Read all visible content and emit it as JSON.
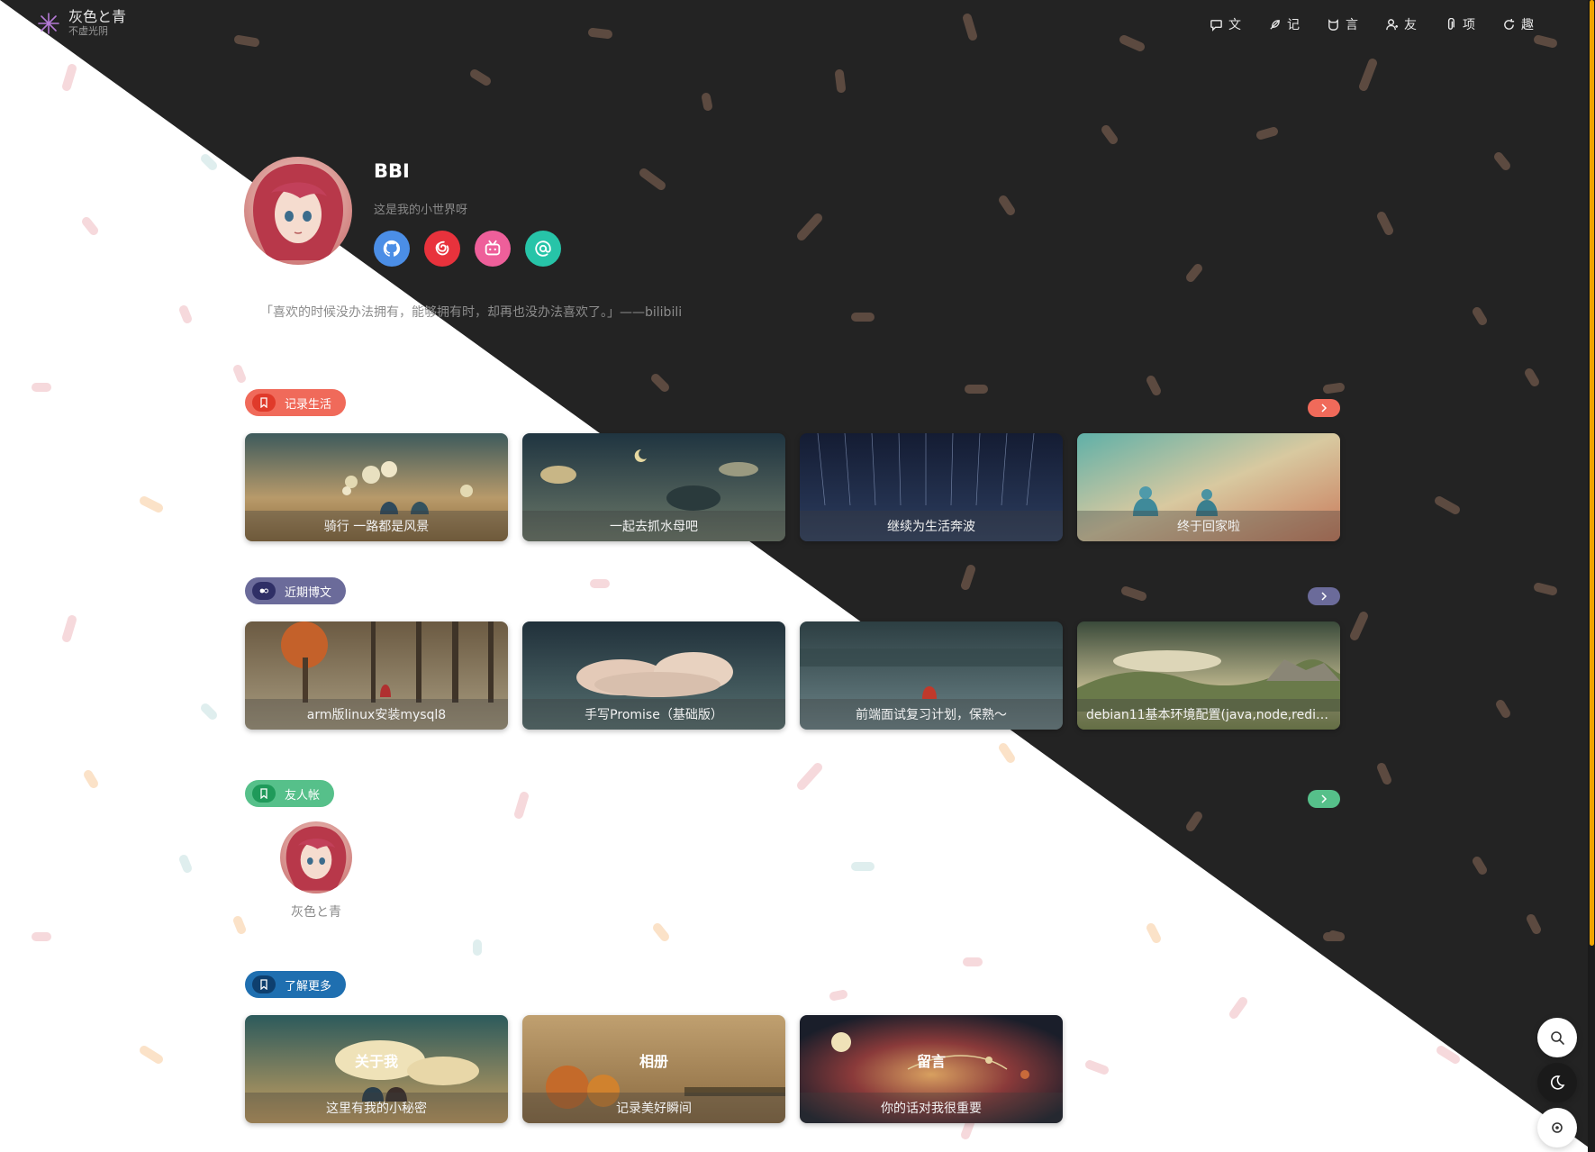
{
  "site": {
    "title": "灰色と青",
    "subtitle": "不虚光阴"
  },
  "nav": [
    {
      "icon": "chat-icon",
      "label": "文"
    },
    {
      "icon": "feather-icon",
      "label": "记"
    },
    {
      "icon": "cat-icon",
      "label": "言"
    },
    {
      "icon": "user-icon",
      "label": "友"
    },
    {
      "icon": "paperclip-icon",
      "label": "项"
    },
    {
      "icon": "refresh-icon",
      "label": "趣"
    }
  ],
  "profile": {
    "name": "BBI",
    "description": "这是我的小世界呀",
    "socials": [
      {
        "icon": "github-icon",
        "color": "#4b8ee6"
      },
      {
        "icon": "netease-music-icon",
        "color": "#e8323c"
      },
      {
        "icon": "bilibili-icon",
        "color": "#ee5f9a"
      },
      {
        "icon": "email-icon",
        "color": "#27c4a8"
      }
    ]
  },
  "quote": "「喜欢的时候没办法拥有，能够拥有时，却再也没办法喜欢了。」——bilibili",
  "sections": {
    "life": {
      "title": "记录生活",
      "color": "#f06a5a",
      "items": [
        "骑行 一路都是风景",
        "一起去抓水母吧",
        "继续为生活奔波",
        "终于回家啦"
      ]
    },
    "posts": {
      "title": "近期博文",
      "color": "#6b6b9a",
      "items": [
        "arm版linux安装mysql8",
        "手写Promise（基础版）",
        "前端面试复习计划，保熟～",
        "debian11基本环境配置(java,node,redis...)"
      ]
    },
    "friends": {
      "title": "友人帐",
      "color": "#56c08a",
      "items": [
        {
          "name": "灰色と青"
        }
      ]
    },
    "more": {
      "title": "了解更多",
      "color": "#1f6fb0",
      "items": [
        {
          "title": "关于我",
          "caption": "这里有我的小秘密"
        },
        {
          "title": "相册",
          "caption": "记录美好瞬间"
        },
        {
          "title": "留言",
          "caption": "你的话对我很重要"
        }
      ]
    }
  },
  "floating": [
    "search-icon",
    "moon-icon",
    "settings-icon"
  ]
}
